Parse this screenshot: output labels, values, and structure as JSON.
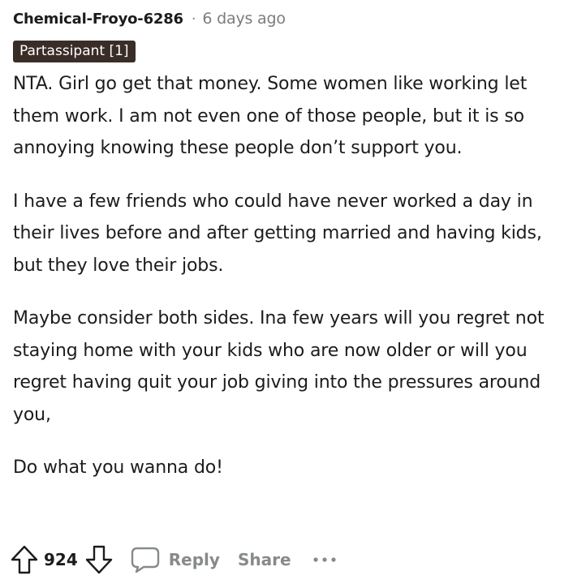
{
  "comment": {
    "author": "Chemical-Froyo-6286",
    "separator": "·",
    "time": "6 days ago",
    "flair": "Partassipant [1]",
    "paragraphs": [
      "NTA. Girl go get that money. Some women like working let them work. I am not even one of those people, but it is so annoying knowing these people don’t support you.",
      "I have a few friends who could have never worked a day in their lives before and after getting married and having kids, but they love their jobs.",
      "Maybe consider both sides. Ina few years will you regret not staying home with your kids who are now older or will you regret having quit your job giving into the pressures around you,",
      "Do what you wanna do!"
    ]
  },
  "actions": {
    "score": "924",
    "reply_label": "Reply",
    "share_label": "Share",
    "icons": [
      "upvote-icon",
      "downvote-icon",
      "comment-bubble-icon",
      "more-options-icon"
    ]
  },
  "colors": {
    "flair_bg": "#3a2d27",
    "muted": "#878a8c",
    "text": "#1c1c1c"
  }
}
